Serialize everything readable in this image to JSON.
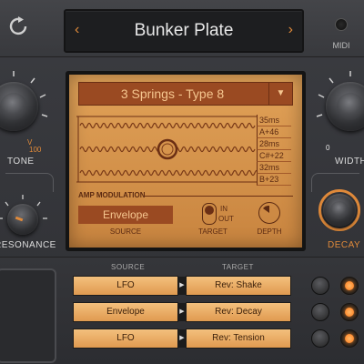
{
  "header": {
    "preset_name": "Bunker Plate",
    "prev_arrow": "‹",
    "next_arrow": "›",
    "midi_label": "MIDI"
  },
  "knobs": {
    "tone": {
      "label": "TONE",
      "tick_value": "100",
      "tick_mark": "V"
    },
    "resonance": {
      "label": "RESONANCE"
    },
    "width": {
      "label": "WIDTH",
      "tick_value": "0"
    },
    "decay": {
      "label": "DECAY"
    }
  },
  "display": {
    "spring_type": "3 Springs - Type 8",
    "dropdown_icon": "▼",
    "spring_params": [
      "35ms",
      "A+46",
      "28ms",
      "C#+22",
      "32ms",
      "B+23"
    ],
    "amp_modulation_label": "AMP MODULATION",
    "source_value": "Envelope",
    "source_label": "SOURCE",
    "target_in": "IN",
    "target_out": "OUT",
    "target_label": "TARGET",
    "depth_label": "DEPTH"
  },
  "mod_matrix": {
    "source_header": "SOURCE",
    "target_header": "TARGET",
    "rows": [
      {
        "source": "LFO",
        "target": "Rev: Shake"
      },
      {
        "source": "Envelope",
        "target": "Rev: Decay"
      },
      {
        "source": "LFO",
        "target": "Rev: Tension"
      }
    ]
  },
  "colors": {
    "accent": "#e08a3a",
    "display_bg": "#d6944c",
    "led": "#ff7a1a"
  }
}
